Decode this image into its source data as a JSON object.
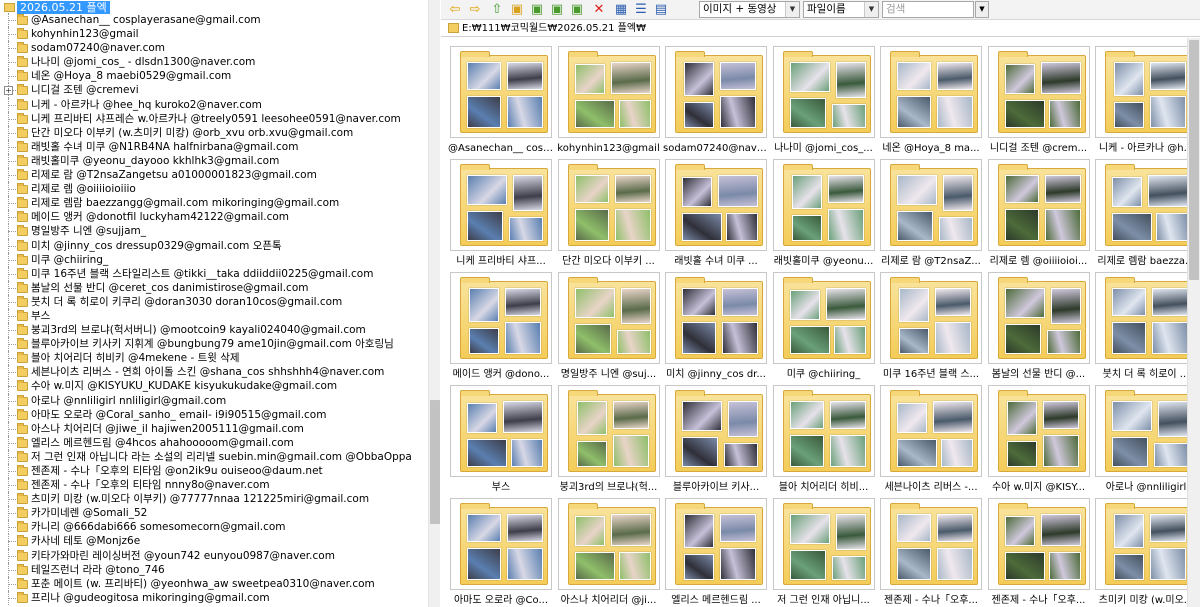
{
  "tree": {
    "root_label": "2026.05.21 플엑",
    "items": [
      {
        "label": "@Asanechan__ cosplayerasane@gmail.com",
        "expandable": false
      },
      {
        "label": "kohynhin123@gmail",
        "expandable": false
      },
      {
        "label": "sodam07240@naver.com",
        "expandable": false
      },
      {
        "label": "나나미 @jomi_cos_ -  dlsdn1300@naver.com",
        "expandable": false
      },
      {
        "label": "네온 @Hoya_8 maebi0529@gmail.com",
        "expandable": false
      },
      {
        "label": "니디걸 조텐 @cremevi",
        "expandable": true
      },
      {
        "label": "니케 - 아르카나 @hee_hq kuroko2@naver.com",
        "expandable": false
      },
      {
        "label": "니케 프리바티 샤프레슨 w.아르카나 @treely0591 leesohee0591@naver.com",
        "expandable": false
      },
      {
        "label": "단간 미오다 이부키 (w.츠미키 미캉) @orb_xvu orb.xvu@gmail.com",
        "expandable": false
      },
      {
        "label": "래빗홀 수녀 미쿠  @N1RB4NA halfnirbana@gmail.com",
        "expandable": false
      },
      {
        "label": "래빗홀미쿠 @yeonu_dayooo kkhlhk3@gmail.com",
        "expandable": false
      },
      {
        "label": "리제로 람 @T2nsaZangetsu a01000001823@gmail.com",
        "expandable": false
      },
      {
        "label": "리제로 렘 @oiiiioioiiio",
        "expandable": false
      },
      {
        "label": "리제로 렘람 baezzangg@gmail.com mikoringing@gmail.com",
        "expandable": false
      },
      {
        "label": "메이드 앵커 @donotfil luckyham42122@gmail.com",
        "expandable": false
      },
      {
        "label": "명일방주 니엔 @sujjam_",
        "expandable": false
      },
      {
        "label": "미치 @jinny_cos  dressup0329@gmail.com 오픈톡",
        "expandable": false
      },
      {
        "label": "미쿠 @chiiring_",
        "expandable": false
      },
      {
        "label": "미쿠 16주년 블랙 스타일리스트 @tikki__taka ddiiddii0225@gmail.com",
        "expandable": false
      },
      {
        "label": "봄날의 선물 반디 @ceret_cos danimistirose@gmail.com",
        "expandable": false
      },
      {
        "label": "붓치 더 록 히로이 키쿠리 @doran3030 doran10cos@gmail.com",
        "expandable": false
      },
      {
        "label": "부스",
        "expandable": false
      },
      {
        "label": "붕괴3rd의 브로냐(헉서버니) @mootcoin9 kayali024040@gmail.com",
        "expandable": false
      },
      {
        "label": "블루아카이브 키사키 지휘계 @bungbung79  ame10jin@gmail.com 아호링님",
        "expandable": false
      },
      {
        "label": "블아 치어리더 히비키 @4mekene - 트윗 삭제",
        "expandable": false
      },
      {
        "label": "세븐나이츠 리버스 - 연희 아이돌 스킨 @shana_cos shhshhh4@naver.com",
        "expandable": false
      },
      {
        "label": "수아 w.미지 @KISYUKU_KUDAKE kisyukukudake@gmail.com",
        "expandable": false
      },
      {
        "label": "아로나  @nnliligirl  nnliligirl@gmail.com",
        "expandable": false
      },
      {
        "label": "아마도 오로라 @Coral_sanho_ email- i9i90515@gmail.com",
        "expandable": false
      },
      {
        "label": "아스나 치어리더 @jiwe_il hajiwen2005111@gmail.com",
        "expandable": false
      },
      {
        "label": "엘리스 메르헨드림 @4hcos ahahooooom@gmail.com",
        "expandable": false
      },
      {
        "label": "저 그런 인재 아닙니다 라는 소설의 리리넬 suebin.min@gmail.com @ObbaOppa",
        "expandable": false
      },
      {
        "label": "젠존제 - 수나「오후의 티타임 @on2ik9u  ouiseoo@daum.net",
        "expandable": false
      },
      {
        "label": "젠존제 - 수나「오후의 티타임 nnny8o@naver.com",
        "expandable": false
      },
      {
        "label": "츠미키 미캉 (w.미오다 이부키) @77777nnaa 121225miri@gmail.com",
        "expandable": false
      },
      {
        "label": "카가미네렌 @Somali_52",
        "expandable": false
      },
      {
        "label": "카니리 @666dabi666 somesomecorn@gmail.com",
        "expandable": false
      },
      {
        "label": "카사네 테토 @Monjz6e",
        "expandable": false
      },
      {
        "label": "키타가와마린 레이싱버전 @youn742 eunyou0987@naver.com",
        "expandable": false
      },
      {
        "label": "테일즈런너 라라 @tono_746",
        "expandable": false
      },
      {
        "label": "포춘 메이트 (w. 프리바티) @yeonhwa_aw sweetpea0310@naver.com",
        "expandable": false
      },
      {
        "label": "프리나 @gudeogitosa mikoringing@gmail.com",
        "expandable": false
      }
    ]
  },
  "toolbar": {
    "view_select": "이미지 + 동영상",
    "sort_select": "파일이름",
    "search_placeholder": "검색",
    "icons": [
      "back-arrow-icon",
      "forward-arrow-icon",
      "up-folder-icon",
      "new-folder-icon",
      "copy-folder-icon",
      "move-folder-icon",
      "paste-folder-icon",
      "delete-icon",
      "view-thumbnails-icon",
      "view-details-icon",
      "view-list-icon"
    ]
  },
  "path": "E:₩111₩코믹월드₩2026.05.21 플엑₩",
  "thumbnails": [
    {
      "caption": "@Asanechan__ cosp..."
    },
    {
      "caption": "kohynhin123@gmail"
    },
    {
      "caption": "sodam07240@nave..."
    },
    {
      "caption": "나나미 @jomi_cos_..."
    },
    {
      "caption": "네온 @Hoya_8 ma..."
    },
    {
      "caption": "니디걸 조텐 @crem..."
    },
    {
      "caption": "니케 - 아르카나 @h..."
    },
    {
      "caption": "니케 프리바티 샤프..."
    },
    {
      "caption": "단간 미오다 이부키 ..."
    },
    {
      "caption": "래빗홀 수녀 미쿠 ..."
    },
    {
      "caption": "래빗홀미쿠 @yeonu..."
    },
    {
      "caption": "리제로 람 @T2nsaZ..."
    },
    {
      "caption": "리제로 렘 @oiiiioioi..."
    },
    {
      "caption": "리제로 렘람 baezza..."
    },
    {
      "caption": "메이드 앵커 @dono..."
    },
    {
      "caption": "명일방주 니엔 @suj..."
    },
    {
      "caption": "미치 @jinny_cos  dr..."
    },
    {
      "caption": "미쿠 @chiiring_"
    },
    {
      "caption": "미쿠 16주년 블랙 스..."
    },
    {
      "caption": "봄날의 선물 반디 @..."
    },
    {
      "caption": "붓치 더 록 히로이 ..."
    },
    {
      "caption": "부스"
    },
    {
      "caption": "붕괴3rd의 브로냐(헉..."
    },
    {
      "caption": "블루아카이브 키사..."
    },
    {
      "caption": "블아 치어리더 히비..."
    },
    {
      "caption": "세븐나이츠 리버스 -..."
    },
    {
      "caption": "수아 w.미지 @KISY..."
    },
    {
      "caption": "아로나  @nnliligirl"
    },
    {
      "caption": "아마도 오로라 @Co..."
    },
    {
      "caption": "아스나 치어리더 @ji..."
    },
    {
      "caption": "엘리스 메르헨드림 ..."
    },
    {
      "caption": "저 그런 인재 아닙니..."
    },
    {
      "caption": "젠존제 - 수나「오후..."
    },
    {
      "caption": "젠존제 - 수나「오후..."
    },
    {
      "caption": "츠미키 미캉 (w.미오..."
    }
  ],
  "colors": {
    "selection": "#3399ff",
    "folder": "#f4cd61",
    "delete_red": "#e0201b"
  }
}
